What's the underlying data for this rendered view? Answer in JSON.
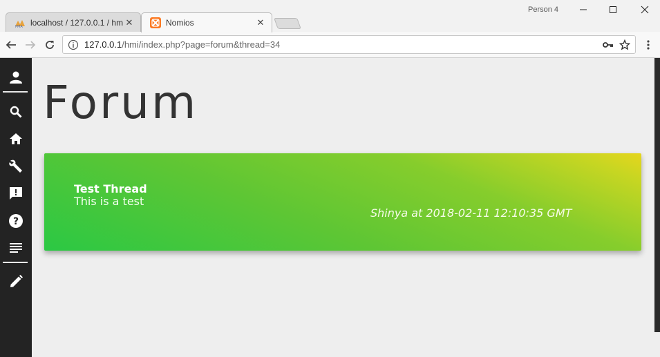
{
  "browser": {
    "tabs": [
      {
        "label": "localhost / 127.0.0.1 / hm",
        "active": false,
        "favicon": "phpmyadmin-icon"
      },
      {
        "label": "Nomios",
        "active": true,
        "favicon": "xampp-icon"
      }
    ],
    "profile": "Person 4",
    "url_host": "127.0.0.1",
    "url_path": "/hmi/index.php?page=forum&thread=34"
  },
  "sidebar": {
    "items": [
      {
        "icon": "user-icon"
      },
      {
        "icon": "search-icon"
      },
      {
        "icon": "home-icon"
      },
      {
        "icon": "wrench-icon"
      },
      {
        "icon": "feedback-icon"
      },
      {
        "icon": "help-icon"
      },
      {
        "icon": "list-icon"
      },
      {
        "icon": "pencil-icon"
      }
    ]
  },
  "page": {
    "title": "Forum",
    "theme_toggle": "moon-icon"
  },
  "thread": {
    "title": "Test Thread",
    "description": "This is a test",
    "meta": "Shinya at 2018-02-11 12:10:35 GMT"
  },
  "colors": {
    "sidebar_bg": "#232323",
    "card_gradient_start": "#2bc844",
    "card_gradient_end": "#e6d51d",
    "page_bg": "#eeeeee"
  }
}
